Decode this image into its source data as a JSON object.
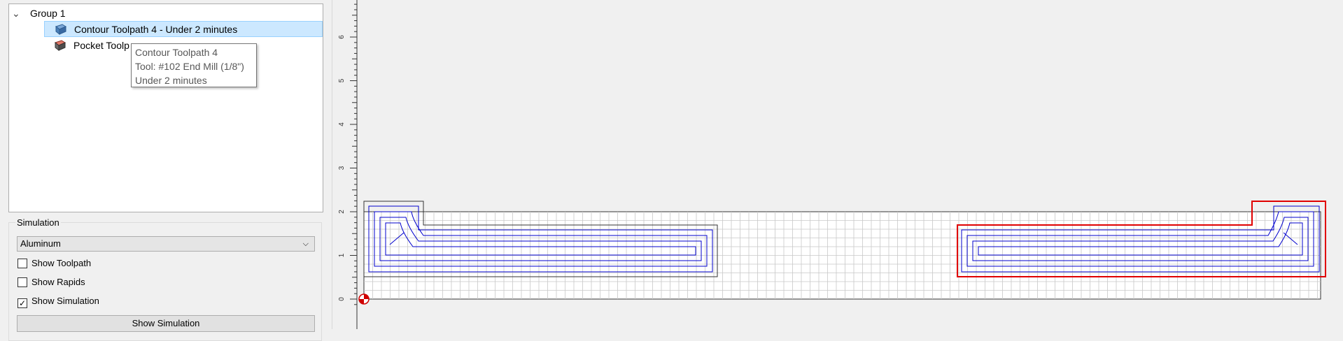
{
  "tree": {
    "group_label": "Group 1",
    "items": [
      {
        "label": "Contour Toolpath 4 - Under 2 minutes",
        "icon": "contour-toolpath-icon",
        "selected": true
      },
      {
        "label": "Pocket Toolp",
        "icon": "pocket-toolpath-icon",
        "selected": false
      }
    ]
  },
  "tooltip": {
    "lines": [
      "Contour Toolpath 4",
      "Tool: #102 End Mill (1/8\")",
      "Under 2 minutes"
    ]
  },
  "simulation": {
    "legend": "Simulation",
    "material": "Aluminum",
    "show_toolpath": {
      "label": "Show Toolpath",
      "checked": false
    },
    "show_rapids": {
      "label": "Show Rapids",
      "checked": false
    },
    "show_simulation": {
      "label": "Show Simulation",
      "checked": true
    },
    "button_label": "Show Simulation"
  },
  "ruler": {
    "tick_labels": [
      "0",
      "1",
      "2",
      "3",
      "4",
      "5",
      "6"
    ]
  },
  "colors": {
    "selection": "#cce8ff",
    "toolpath": "#0000cc",
    "selected_outline": "#e00000",
    "grid": "#c8c8c8"
  }
}
